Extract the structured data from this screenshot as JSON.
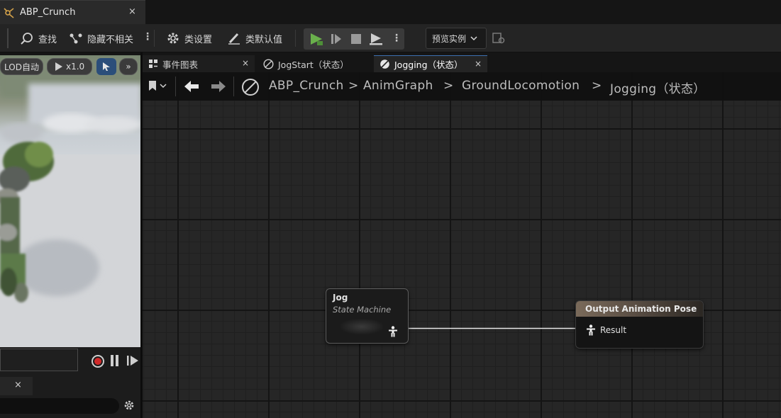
{
  "window": {
    "doc_tab_label": "ABP_Crunch",
    "close_glyph": "×"
  },
  "toolbar": {
    "find_label": "查找",
    "hide_unrelated_label": "隐藏不相关",
    "class_settings_label": "类设置",
    "class_defaults_label": "类默认值",
    "preview_instance_label": "预览实例",
    "play_color": "#6ab04c"
  },
  "viewport": {
    "lod_label": "LOD自动",
    "speed_label": "x1.0",
    "more_glyph": "»",
    "select_color": "#2b4e7a"
  },
  "graph_tabs": [
    {
      "label": "事件图表",
      "icon": "event-graph-icon",
      "active": false
    },
    {
      "label": "JogStart（状态）",
      "icon": "state-icon",
      "active": false
    },
    {
      "label": "Jogging（状态）",
      "icon": "state-icon",
      "active": true
    }
  ],
  "breadcrumb": {
    "items": [
      "ABP_Crunch",
      "AnimGraph",
      "GroundLocomotion",
      "Jogging（状态）"
    ],
    "separator": ">"
  },
  "nodes": {
    "jog": {
      "title": "Jog",
      "subtitle": "State Machine"
    },
    "output": {
      "title": "Output Animation Pose",
      "pin_label": "Result",
      "header_color": "#7a6a5a"
    }
  }
}
